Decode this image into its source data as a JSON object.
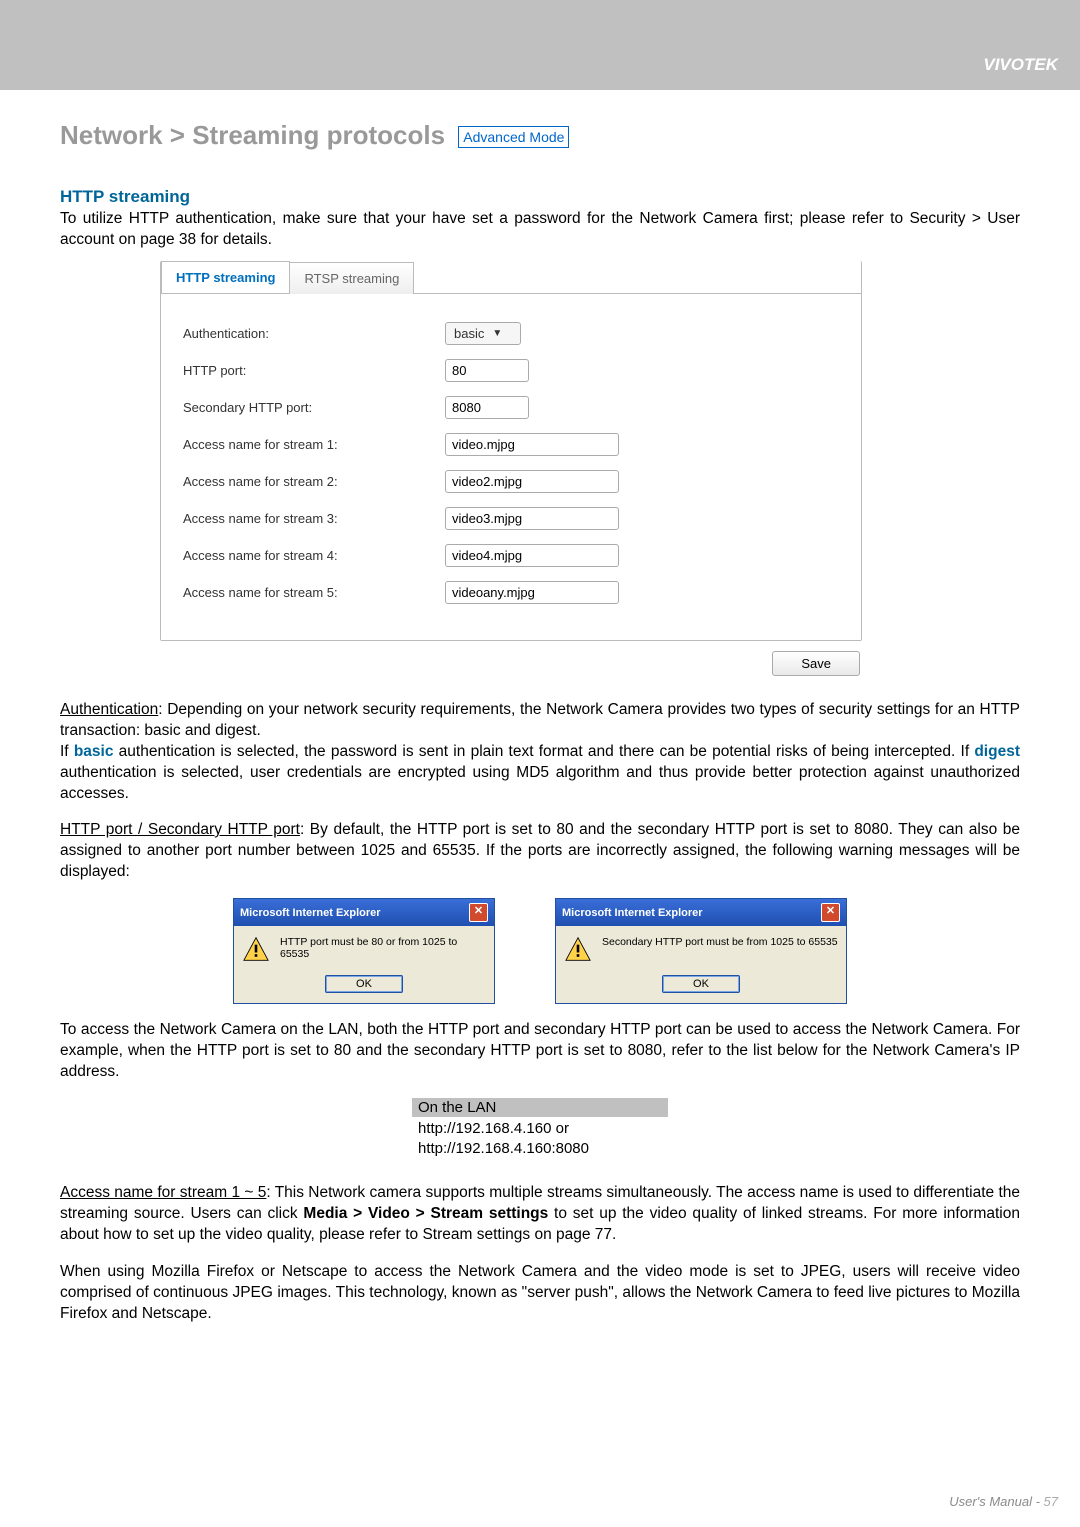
{
  "brand": "VIVOTEK",
  "heading": "Network > Streaming protocols",
  "mode_badge": "Advanced Mode",
  "section1": {
    "title": "HTTP streaming",
    "intro": "To utilize HTTP authentication, make sure that your have set a password for the Network Camera first; please refer to Security > User account on page 38 for details."
  },
  "tabs": {
    "http": "HTTP streaming",
    "rtsp": "RTSP streaming"
  },
  "form": {
    "auth_label": "Authentication:",
    "auth_value": "basic",
    "http_port_label": "HTTP port:",
    "http_port_value": "80",
    "sec_http_port_label": "Secondary HTTP port:",
    "sec_http_port_value": "8080",
    "s1_label": "Access name for stream 1:",
    "s1_value": "video.mjpg",
    "s2_label": "Access name for stream 2:",
    "s2_value": "video2.mjpg",
    "s3_label": "Access name for stream 3:",
    "s3_value": "video3.mjpg",
    "s4_label": "Access name for stream 4:",
    "s4_value": "video4.mjpg",
    "s5_label": "Access name for stream 5:",
    "s5_value": "videoany.mjpg",
    "save": "Save"
  },
  "para_auth_heading": "Authentication",
  "para_auth_1": ": Depending on your network security requirements, the Network Camera provides two types of security settings for an HTTP transaction: basic and digest.",
  "para_auth_2a": "If ",
  "para_auth_basic": "basic",
  "para_auth_2b": " authentication is selected, the password is sent in plain text format and there can be potential risks of being intercepted. If ",
  "para_auth_digest": "digest",
  "para_auth_2c": " authentication is selected, user credentials are encrypted using MD5 algorithm and thus provide better protection against unauthorized accesses.",
  "para_ports_heading": "HTTP port / Secondary HTTP port",
  "para_ports_body": ": By default, the HTTP port is set to 80 and the secondary HTTP port is set to 8080. They can also be assigned to another port number between 1025 and 65535. If the ports are incorrectly assigned, the following warning messages will be displayed:",
  "dlg_title": "Microsoft Internet Explorer",
  "dlg_ok": "OK",
  "dlg1_msg": "HTTP port must be 80 or from 1025 to 65535",
  "dlg2_msg": "Secondary HTTP port must be from 1025 to 65535",
  "para_lan": "To access the Network Camera on the LAN, both the HTTP port and secondary HTTP port can be used to access the Network Camera. For example, when the HTTP port is set to 80 and the secondary HTTP port is set to 8080, refer to the list below for the Network Camera's IP address.",
  "lan_head": "On the LAN",
  "lan_l1": "http://192.168.4.160  or",
  "lan_l2": "http://192.168.4.160:8080",
  "para_access_heading": "Access name for stream 1 ~ 5",
  "para_access_body1": ": This Network camera supports multiple streams simultaneously. The access name is used to differentiate the streaming source. Users can click ",
  "para_access_bold": "Media > Video > Stream settings",
  "para_access_body2": " to set up the video quality of linked streams. For more information about how to set up the video quality, please refer to Stream settings on page 77.",
  "para_firefox": "When using Mozilla Firefox or Netscape to access the Network Camera and the video mode is set to JPEG, users will receive video comprised of continuous JPEG images. This technology, known as \"server push\", allows the Network Camera to feed live pictures to Mozilla Firefox and Netscape.",
  "footer_label": "User's Manual - ",
  "footer_page": "57"
}
